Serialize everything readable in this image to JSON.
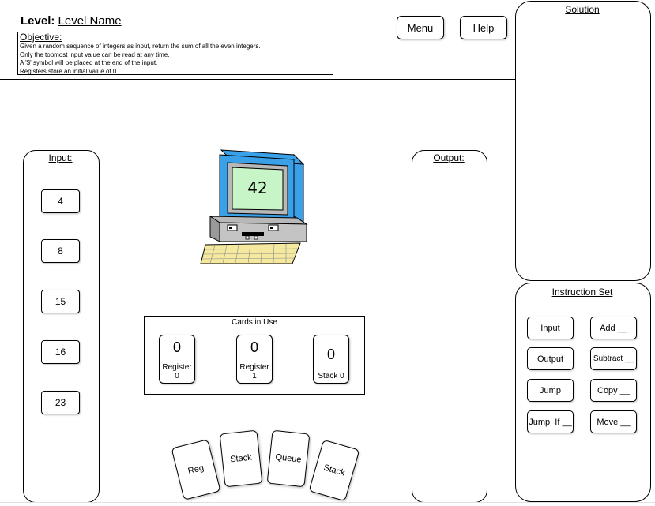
{
  "header": {
    "level_label": "Level:",
    "level_name": "Level Name",
    "objective_title": "Objective:",
    "objective_lines": [
      "Given a random sequence of integers as input, return the sum of all the even integers.",
      "Only the topmost input value can be read at any time.",
      "A '$' symbol will be placed at the end of the input.",
      "Registers store an initial value of 0."
    ],
    "menu_label": "Menu",
    "help_label": "Help"
  },
  "input_panel": {
    "title": "Input:",
    "values": [
      "4",
      "8",
      "15",
      "16",
      "23"
    ]
  },
  "computer": {
    "screen_value": "42",
    "colors": {
      "blue": "#3aa0e8",
      "screen": "#c8f5c8",
      "body": "#b8b8b8"
    }
  },
  "output_panel": {
    "title": "Output:"
  },
  "cards_in_use": {
    "title": "Cards in Use",
    "cards": [
      {
        "value": "0",
        "label_line1": "Register",
        "label_line2": "0"
      },
      {
        "value": "0",
        "label_line1": "Register",
        "label_line2": "1"
      },
      {
        "value": "0",
        "label_line1": "Stack 0",
        "label_line2": ""
      }
    ]
  },
  "card_deck": [
    "Reg",
    "Stack",
    "Queue",
    "Stack"
  ],
  "solution_panel": {
    "title": "Solution"
  },
  "instruction_set": {
    "title": "Instruction Set",
    "items": [
      "Input",
      "Add __",
      "Output",
      "Subtract __",
      "Jump",
      "Copy __",
      "Jump  If __",
      "Move __"
    ]
  }
}
